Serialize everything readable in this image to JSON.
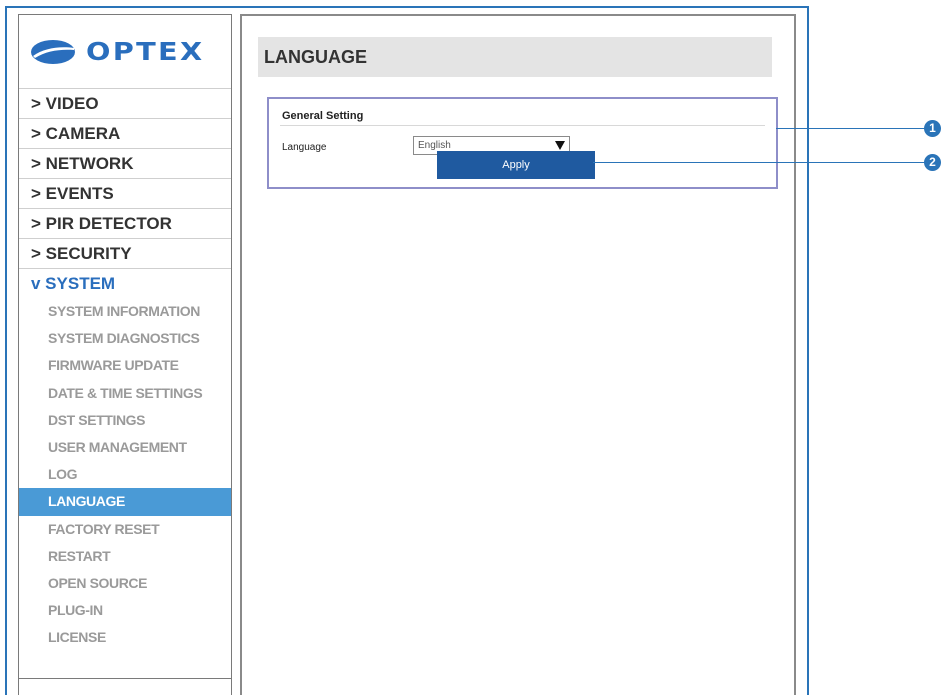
{
  "brand": {
    "logo_text": "OPTEX",
    "accent_color": "#2a74b8"
  },
  "sidebar": {
    "nav": [
      {
        "label": "> VIDEO",
        "active": false
      },
      {
        "label": "> CAMERA",
        "active": false
      },
      {
        "label": "> NETWORK",
        "active": false
      },
      {
        "label": "> EVENTS",
        "active": false
      },
      {
        "label": "> PIR DETECTOR",
        "active": false
      },
      {
        "label": "> SECURITY",
        "active": false
      },
      {
        "label": "v SYSTEM",
        "active": true
      }
    ],
    "system_items": [
      {
        "label": "SYSTEM INFORMATION"
      },
      {
        "label": "SYSTEM DIAGNOSTICS"
      },
      {
        "label": "FIRMWARE UPDATE"
      },
      {
        "label": "DATE & TIME SETTINGS"
      },
      {
        "label": "DST SETTINGS"
      },
      {
        "label": "USER MANAGEMENT"
      },
      {
        "label": "LOG"
      },
      {
        "label": "LANGUAGE",
        "selected": true
      },
      {
        "label": "FACTORY RESET"
      },
      {
        "label": "RESTART"
      },
      {
        "label": "OPEN SOURCE"
      },
      {
        "label": "PLUG-IN"
      },
      {
        "label": "LICENSE"
      }
    ]
  },
  "main": {
    "title": "LANGUAGE",
    "general_setting": {
      "title": "General Setting",
      "language_label": "Language",
      "language_value": "English"
    },
    "apply_label": "Apply"
  },
  "callouts": {
    "one": "1",
    "two": "2"
  }
}
